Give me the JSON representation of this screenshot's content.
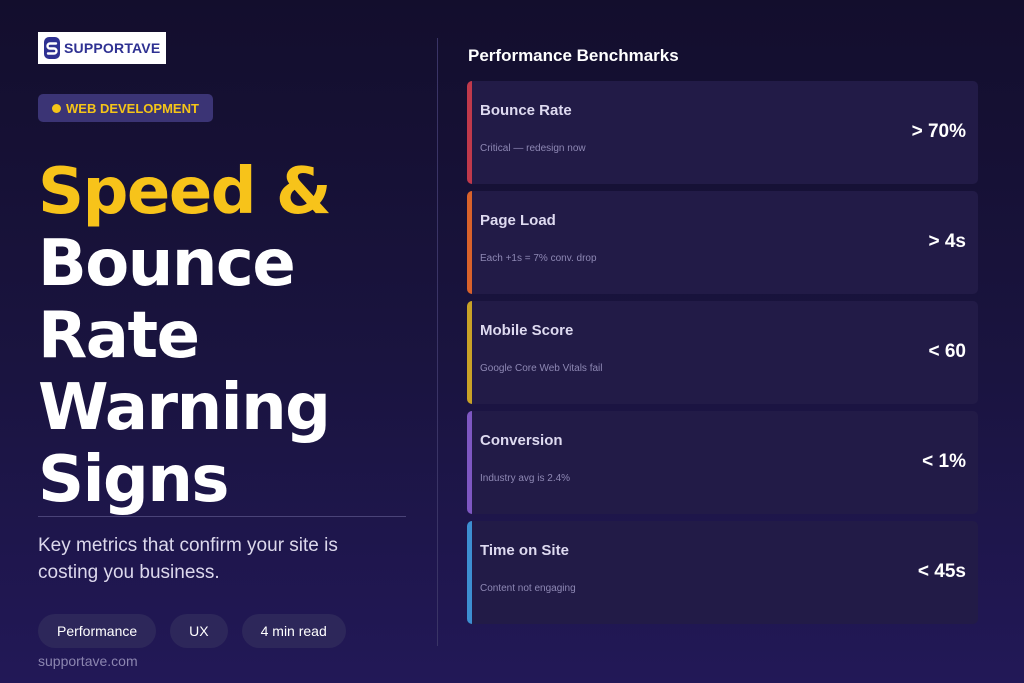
{
  "brand": {
    "name": "SUPPORTAVE",
    "icon": "supportave-logo-icon",
    "color": "#2e3192"
  },
  "category": {
    "label": "WEB DEVELOPMENT",
    "color": "#f5c518"
  },
  "headline": {
    "highlight": "Speed &",
    "lines": [
      "Bounce",
      "Rate",
      "Warning",
      "Signs"
    ]
  },
  "subtitle": "Key metrics that confirm your site is costing you business.",
  "tags": [
    "Performance",
    "UX",
    "4 min read"
  ],
  "site": "supportave.com",
  "panel": {
    "title": "Performance Benchmarks",
    "items": [
      {
        "label": "Bounce Rate",
        "note": "Critical — redesign now",
        "value": "> 70%",
        "color": "#c0394b"
      },
      {
        "label": "Page Load",
        "note": "Each +1s = 7% conv. drop",
        "value": "> 4s",
        "color": "#d9622b"
      },
      {
        "label": "Mobile Score",
        "note": "Google Core Web Vitals fail",
        "value": "< 60",
        "color": "#c9a227"
      },
      {
        "label": "Conversion",
        "note": "Industry avg is 2.4%",
        "value": "< 1%",
        "color": "#7e57c2"
      },
      {
        "label": "Time on Site",
        "note": "Content not engaging",
        "value": "< 45s",
        "color": "#3d8fd1"
      }
    ]
  }
}
